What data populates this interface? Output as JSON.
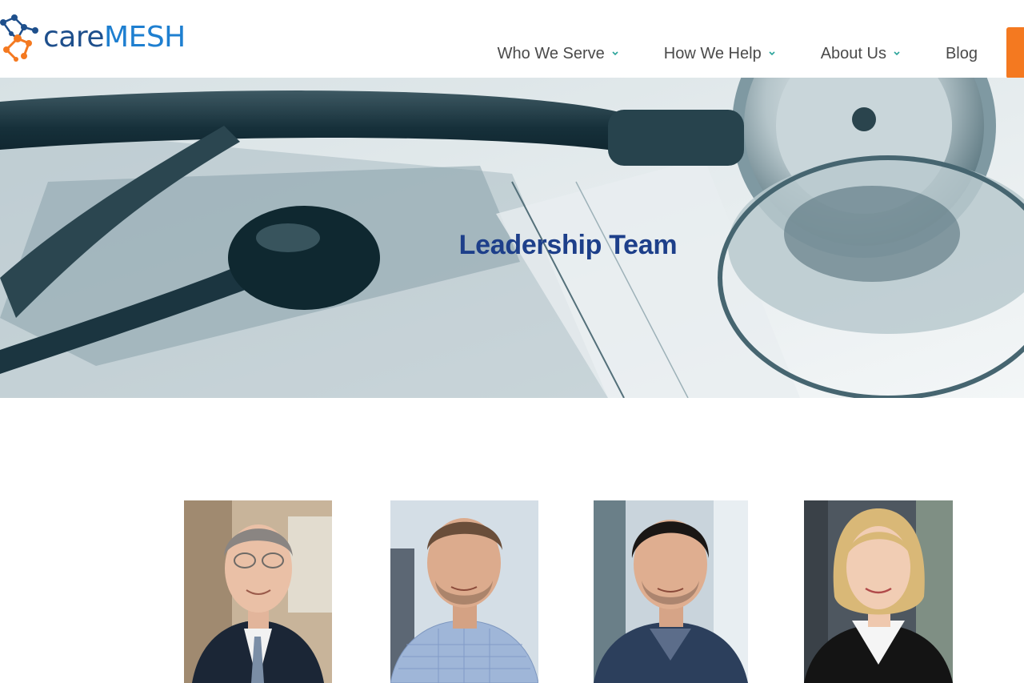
{
  "brand": {
    "name_part1": "care",
    "name_part2": "MESH",
    "colors": {
      "care": "#1e4f8c",
      "mesh": "#1e7fd0",
      "accent": "#f47920"
    }
  },
  "nav": {
    "items": [
      {
        "label": "Who We Serve",
        "has_dropdown": true
      },
      {
        "label": "How We Help",
        "has_dropdown": true
      },
      {
        "label": "About Us",
        "has_dropdown": true
      },
      {
        "label": "Blog",
        "has_dropdown": false
      }
    ],
    "chevron_color": "#2aa39a"
  },
  "hero": {
    "title": "Leadership Team",
    "title_color": "#1d3f8a",
    "image": "stethoscope-photo"
  },
  "team": {
    "members": [
      {
        "photo": "leader-photo-1"
      },
      {
        "photo": "leader-photo-2"
      },
      {
        "photo": "leader-photo-3"
      },
      {
        "photo": "leader-photo-4"
      }
    ]
  }
}
